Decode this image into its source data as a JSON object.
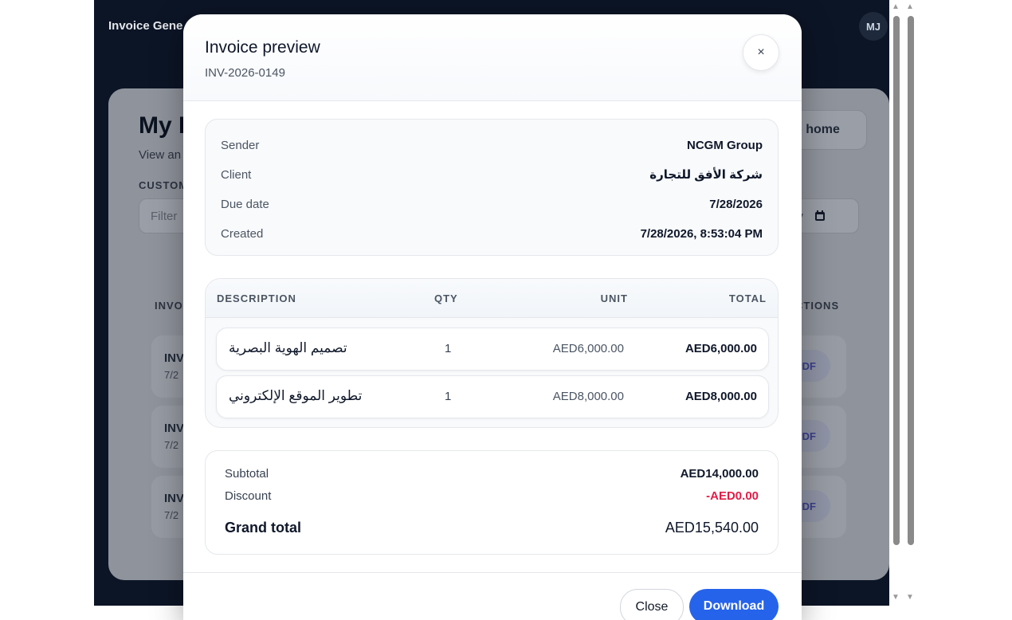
{
  "app": {
    "title": "Invoice Gene",
    "avatar": "MJ"
  },
  "list_page": {
    "title": "My I",
    "subtitle": "View an",
    "filter_label": "CUSTOM",
    "filter_placeholder": "Filter",
    "home_button": "o home",
    "date_placeholder": "yy",
    "col_invoice": "INVO",
    "col_actions": "CTIONS",
    "rows": [
      {
        "id": "INV",
        "date": "7/2",
        "action": "PDF"
      },
      {
        "id": "INV",
        "date": "7/2",
        "action": "PDF"
      },
      {
        "id": "INV",
        "date": "7/2",
        "action": "PDF"
      }
    ]
  },
  "modal": {
    "title": "Invoice preview",
    "invoice_number": "INV-2026-0149",
    "close_symbol": "×",
    "meta": {
      "sender_label": "Sender",
      "sender": "NCGM Group",
      "client_label": "Client",
      "client": "شركة الأفق للتجارة",
      "due_label": "Due date",
      "due": "7/28/2026",
      "created_label": "Created",
      "created": "7/28/2026, 8:53:04 PM"
    },
    "items_header": {
      "description": "DESCRIPTION",
      "qty": "QTY",
      "unit": "UNIT",
      "total": "TOTAL"
    },
    "items": [
      {
        "description": "تصميم الهوية البصرية",
        "qty": "1",
        "unit": "AED6,000.00",
        "total": "AED6,000.00"
      },
      {
        "description": "تطوير الموقع الإلكتروني",
        "qty": "1",
        "unit": "AED8,000.00",
        "total": "AED8,000.00"
      }
    ],
    "totals": {
      "subtotal_label": "Subtotal",
      "subtotal": "AED14,000.00",
      "discount_label": "Discount",
      "discount": "-AED0.00",
      "grand_label": "Grand total",
      "grand": "AED15,540.00"
    },
    "footer": {
      "close_label": "Close",
      "download_label": "Download"
    }
  },
  "colors": {
    "accent": "#2563eb",
    "discount": "#e11d48",
    "backdrop": "#0c1526"
  }
}
